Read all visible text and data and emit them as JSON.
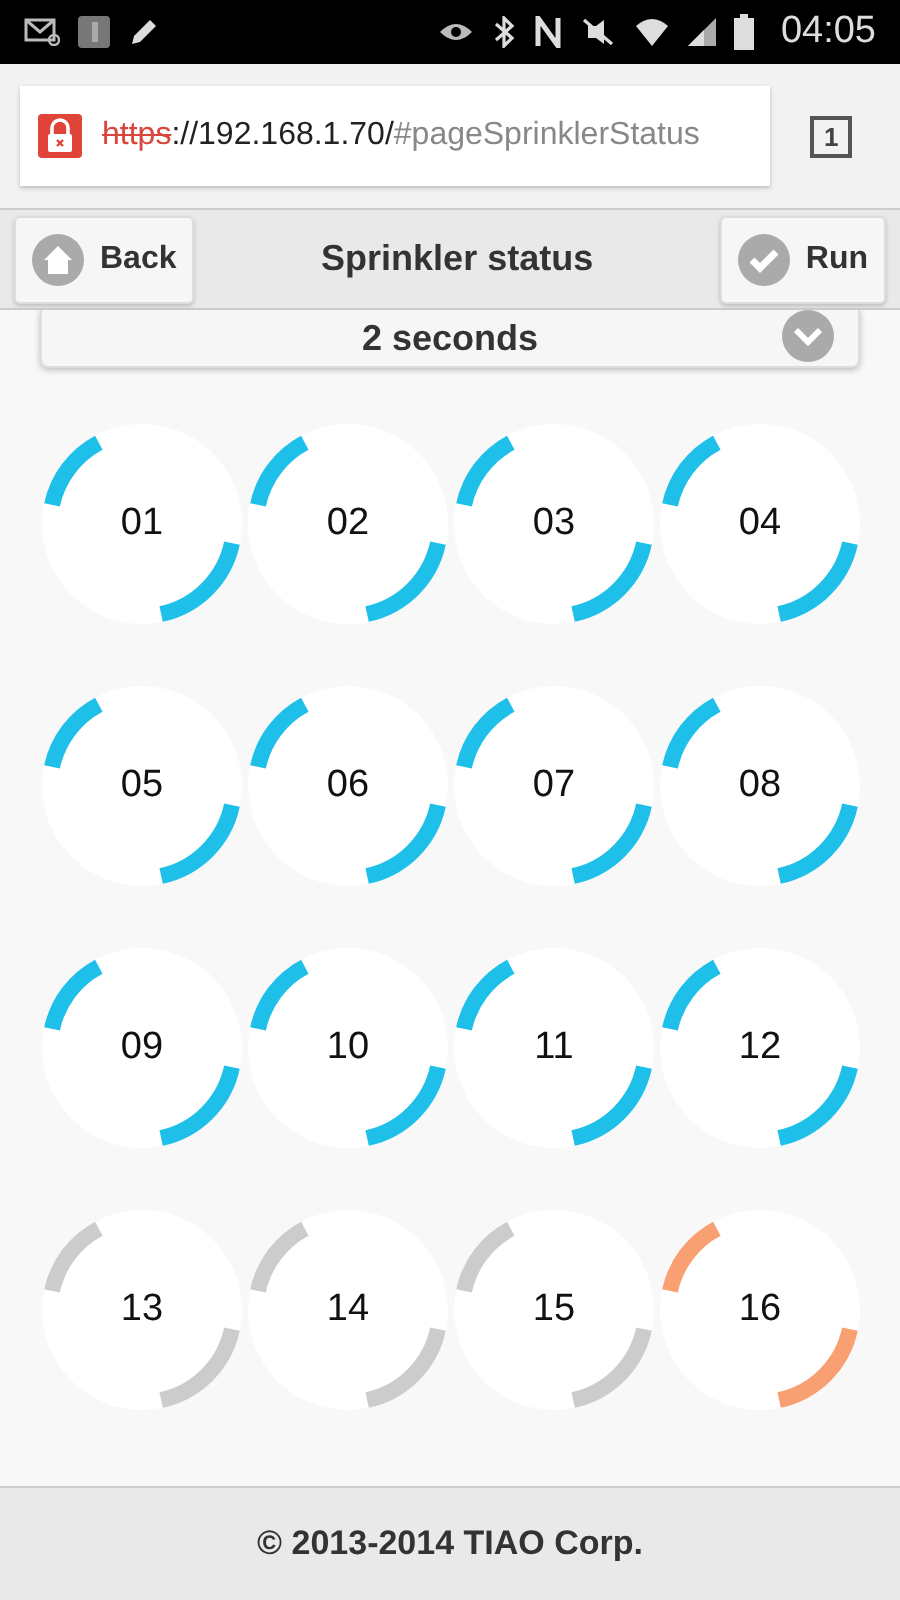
{
  "status_bar": {
    "time": "04:05"
  },
  "address_bar": {
    "scheme": "https",
    "url_host": "://192.168.1.70/",
    "url_path": "#pageSprinklerStatus",
    "tab_count": "1"
  },
  "header": {
    "title": "Sprinkler status",
    "back_label": "Back",
    "run_label": "Run"
  },
  "duration_select": {
    "value": "2 seconds"
  },
  "zones": [
    {
      "label": "01",
      "color": "#1ec0ea"
    },
    {
      "label": "02",
      "color": "#1ec0ea"
    },
    {
      "label": "03",
      "color": "#1ec0ea"
    },
    {
      "label": "04",
      "color": "#1ec0ea"
    },
    {
      "label": "05",
      "color": "#1ec0ea"
    },
    {
      "label": "06",
      "color": "#1ec0ea"
    },
    {
      "label": "07",
      "color": "#1ec0ea"
    },
    {
      "label": "08",
      "color": "#1ec0ea"
    },
    {
      "label": "09",
      "color": "#1ec0ea"
    },
    {
      "label": "10",
      "color": "#1ec0ea"
    },
    {
      "label": "11",
      "color": "#1ec0ea"
    },
    {
      "label": "12",
      "color": "#1ec0ea"
    },
    {
      "label": "13",
      "color": "#cccccc"
    },
    {
      "label": "14",
      "color": "#cccccc"
    },
    {
      "label": "15",
      "color": "#cccccc"
    },
    {
      "label": "16",
      "color": "#f9a073"
    }
  ],
  "footer": {
    "text": "© 2013-2014 TIAO Corp."
  }
}
